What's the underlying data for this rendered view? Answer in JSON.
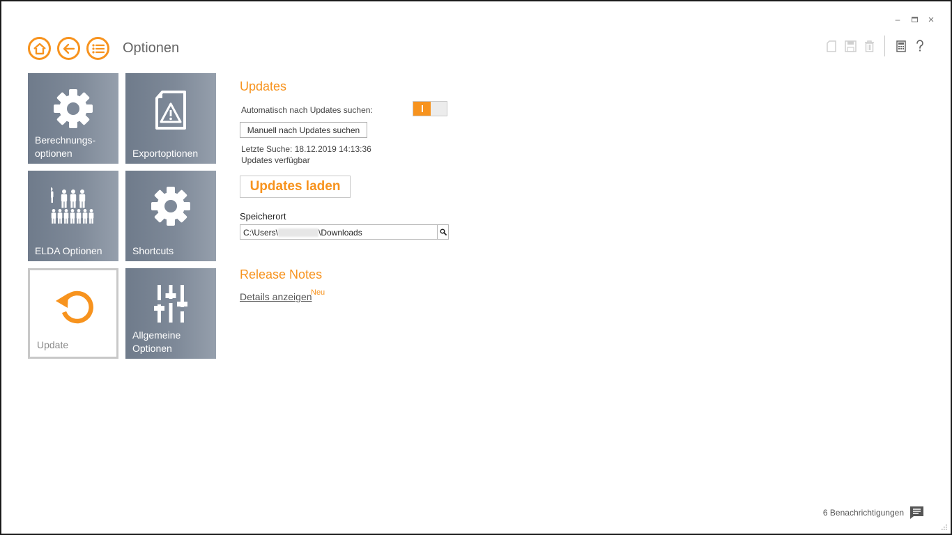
{
  "window": {
    "minimize": "–",
    "maximize": "□",
    "close": "×"
  },
  "header": {
    "title": "Optionen"
  },
  "tiles": [
    {
      "label": "Berechnungs-\noptionen",
      "icon": "gear-icon"
    },
    {
      "label": "Exportoptionen",
      "icon": "document-warning-icon"
    },
    {
      "label": "ELDA Optionen",
      "icon": "people-icon"
    },
    {
      "label": "Shortcuts",
      "icon": "gear-icon"
    },
    {
      "label": "Update",
      "icon": "refresh-icon",
      "active": true
    },
    {
      "label": "Allgemeine\nOptionen",
      "icon": "sliders-icon"
    }
  ],
  "updates": {
    "heading": "Updates",
    "auto_label": "Automatisch nach Updates suchen:",
    "auto_enabled": true,
    "manual_button": "Manuell nach Updates suchen",
    "last_search": "Letzte Suche: 18.12.2019 14:13:36",
    "status": "Updates verfügbar",
    "load_button": "Updates laden",
    "storage_label": "Speicherort",
    "path_prefix": "C:\\Users\\",
    "path_suffix": "\\Downloads"
  },
  "release_notes": {
    "heading": "Release Notes",
    "link": "Details anzeigen",
    "badge": "Neu"
  },
  "footer": {
    "notifications": "6 Benachrichtigungen"
  },
  "colors": {
    "accent": "#f7931e",
    "tile": "#7e8998"
  }
}
